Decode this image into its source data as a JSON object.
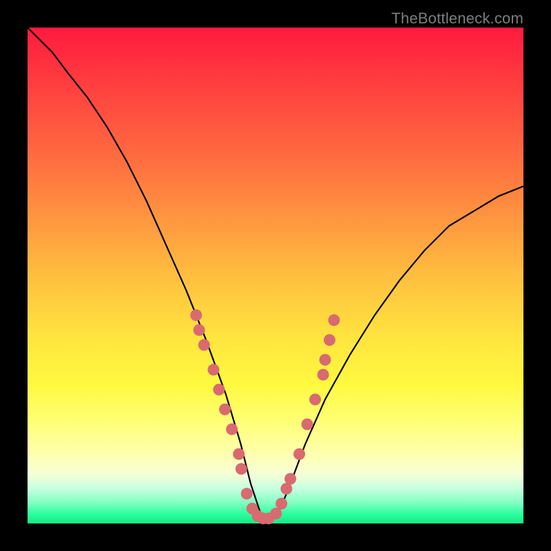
{
  "watermark": "TheBottleneck.com",
  "colors": {
    "background_frame": "#000000",
    "marker": "#d86a70",
    "curve": "#000000",
    "gradient_top": "#ff1a3f",
    "gradient_bottom": "#17e886"
  },
  "chart_data": {
    "type": "line",
    "title": "",
    "xlabel": "",
    "ylabel": "",
    "xlim": [
      0,
      100
    ],
    "ylim": [
      0,
      100
    ],
    "grid": false,
    "legend": false,
    "description": "V-shaped bottleneck curve over rainbow gradient. Y values represent bottleneck percentage (0 = ideal, green zone). X represents component performance ratio. Minimum near x≈47.",
    "series": [
      {
        "name": "bottleneck-curve",
        "x": [
          0,
          2,
          5,
          8,
          12,
          16,
          20,
          24,
          28,
          32,
          36,
          40,
          43,
          45,
          47,
          49,
          51,
          53,
          56,
          60,
          65,
          70,
          75,
          80,
          85,
          90,
          95,
          100
        ],
        "values": [
          100,
          98,
          95,
          91,
          86,
          80,
          73,
          65,
          56,
          47,
          37,
          26,
          16,
          8,
          2,
          1,
          3,
          8,
          16,
          25,
          34,
          42,
          49,
          55,
          60,
          63,
          66,
          68
        ]
      }
    ],
    "markers": {
      "comment": "Salmon dots along both arms of the V near the bottom, approximated from pixels.",
      "points": [
        {
          "x": 34.0,
          "y": 42
        },
        {
          "x": 34.6,
          "y": 39
        },
        {
          "x": 35.6,
          "y": 36
        },
        {
          "x": 37.5,
          "y": 31
        },
        {
          "x": 38.6,
          "y": 27
        },
        {
          "x": 39.8,
          "y": 23
        },
        {
          "x": 41.2,
          "y": 19
        },
        {
          "x": 42.6,
          "y": 14
        },
        {
          "x": 43.1,
          "y": 11
        },
        {
          "x": 44.2,
          "y": 6
        },
        {
          "x": 45.3,
          "y": 3
        },
        {
          "x": 46.4,
          "y": 1.5
        },
        {
          "x": 47.5,
          "y": 1
        },
        {
          "x": 48.6,
          "y": 1
        },
        {
          "x": 50.1,
          "y": 2
        },
        {
          "x": 51.2,
          "y": 4
        },
        {
          "x": 52.2,
          "y": 7
        },
        {
          "x": 53.0,
          "y": 9
        },
        {
          "x": 54.8,
          "y": 14
        },
        {
          "x": 56.4,
          "y": 20
        },
        {
          "x": 58.0,
          "y": 25
        },
        {
          "x": 59.6,
          "y": 30
        },
        {
          "x": 60.0,
          "y": 33
        },
        {
          "x": 60.9,
          "y": 37
        },
        {
          "x": 61.8,
          "y": 41
        }
      ]
    }
  }
}
